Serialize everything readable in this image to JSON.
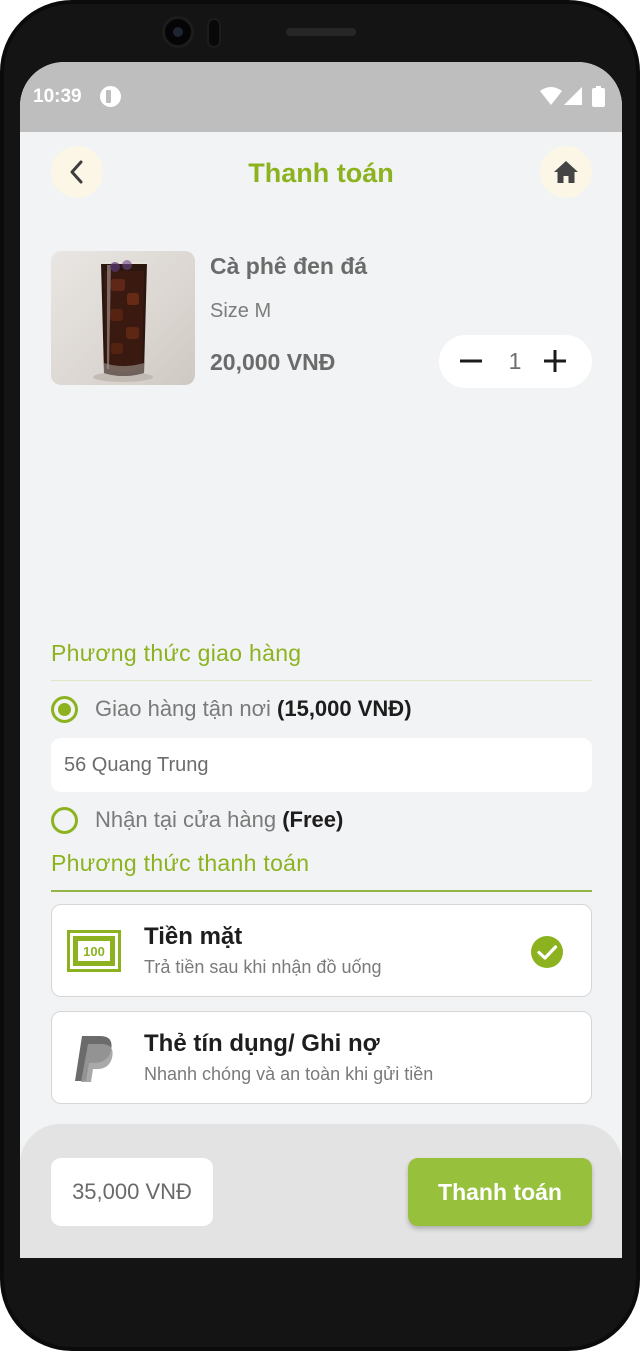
{
  "status_bar": {
    "time": "10:39"
  },
  "header": {
    "title": "Thanh toán"
  },
  "product": {
    "name": "Cà phê đen đá",
    "size": "Size M",
    "price": "20,000 VNĐ",
    "quantity": "1"
  },
  "delivery": {
    "section_title": "Phương thức giao hàng",
    "options": [
      {
        "label": "Giao hàng tận nơi",
        "extra": "(15,000 VNĐ)",
        "selected": true
      },
      {
        "label": "Nhận tại cửa hàng",
        "extra": "(Free)",
        "selected": false
      }
    ],
    "address_value": "56 Quang Trung"
  },
  "payment": {
    "section_title": "Phương thức thanh toán",
    "methods": [
      {
        "title": "Tiền mặt",
        "description": "Trả tiền sau khi nhận đồ uống",
        "icon": "cash-icon",
        "selected": true
      },
      {
        "title": "Thẻ tín dụng/ Ghi nợ",
        "description": "Nhanh chóng và an toàn khi gửi tiền",
        "icon": "paypal-icon",
        "selected": false
      }
    ]
  },
  "footer": {
    "total": "35,000 VNĐ",
    "pay_button_label": "Thanh toán"
  },
  "colors": {
    "accent": "#8cb31f",
    "button": "#97c13d",
    "background": "#f2f3f4"
  }
}
